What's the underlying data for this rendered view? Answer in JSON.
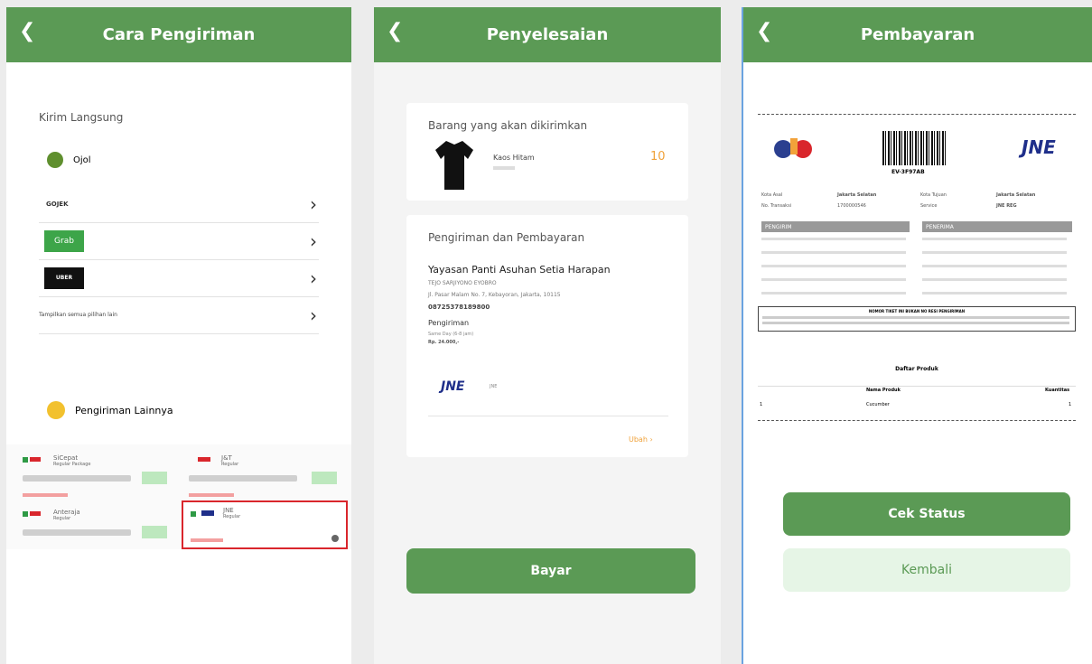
{
  "panel1": {
    "header": {
      "back_icon": "chevron-left-icon",
      "title": "Cara Pengiriman"
    },
    "section_direct": "Kirim Langsung",
    "ojol_label": "Ojol",
    "options": [
      {
        "label": "GOJEK"
      },
      {
        "label": "Grab"
      },
      {
        "label": "UBER"
      },
      {
        "label": "Tampilkan semua pilihan lain"
      }
    ],
    "section_other": "Pengiriman Lainnya",
    "mini_cards": [
      {
        "name": "SiCepat",
        "sub": "Regular Package"
      },
      {
        "name": "J&T",
        "sub": "Regular"
      },
      {
        "name": "Anteraja",
        "sub": "Regular"
      },
      {
        "name": "JNE",
        "sub": "Regular"
      }
    ]
  },
  "panel2": {
    "header": {
      "back_icon": "chevron-left-icon",
      "title": "Penyelesaian"
    },
    "items_heading": "Barang yang akan dikirimkan",
    "product": {
      "name": "Kaos Hitam",
      "qty": "10"
    },
    "ship_heading": "Pengiriman dan Pembayaran",
    "recipient": {
      "name": "Yayasan Panti Asuhan Setia Harapan",
      "contact": "TEJO SARJIYONO EYOBRO",
      "address": "Jl. Pasar Malam No. 7, Kebayoran, Jakarta, 10115",
      "phone": "08725378189800"
    },
    "shipping_label": "Pengiriman",
    "shipping_detail": "Same Day (6-8 jam)",
    "shipping_price": "Rp. 24.000,-",
    "courier": "JNE",
    "change_link": "Ubah",
    "pay_button": "Bayar"
  },
  "panel3": {
    "header": {
      "back_icon": "chevron-left-icon",
      "title": "Pembayaran"
    },
    "receipt": {
      "tracking": "EV-3F97AB",
      "info_rows": [
        {
          "k1": "Kota Asal",
          "v1": "Jakarta Selatan",
          "k2": "Kota Tujuan",
          "v2": "Jakarta Selatan"
        },
        {
          "k1": "No. Transaksi",
          "v1": "1700000546",
          "k2": "Service",
          "v2": "JNE REG"
        }
      ],
      "sender_label": "PENGIRIM",
      "receiver_label": "PENERIMA",
      "notice_title": "NOMOR TIKET INI BUKAN NO RESI PENGIRIMAN",
      "product_list_label": "Daftar Produk",
      "col_name": "Nama Produk",
      "col_qty": "Kuantitas",
      "product_row": {
        "no": "1",
        "name": "Cucumber",
        "qty": "1"
      }
    },
    "check_button": "Cek Status",
    "back_button": "Kembali"
  },
  "colors": {
    "primary": "#5b9a55",
    "light_green": "#e6f5e6",
    "accent_orange": "#f0a23a",
    "highlight_red": "#d9262c"
  }
}
